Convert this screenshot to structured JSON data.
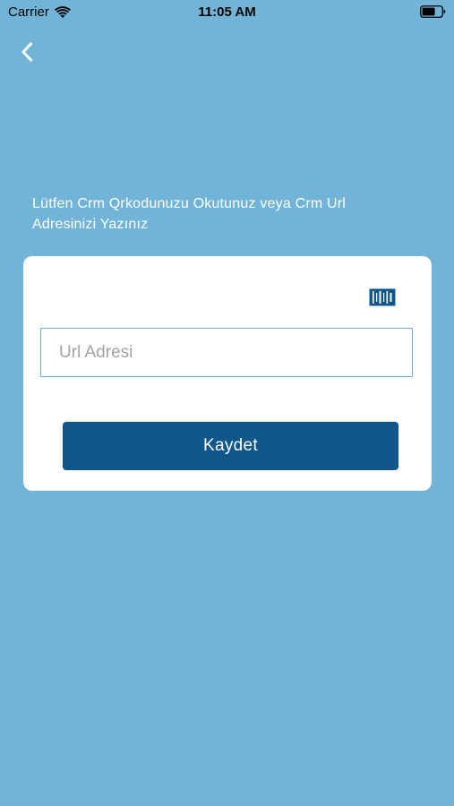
{
  "status_bar": {
    "carrier": "Carrier",
    "time": "11:05 AM"
  },
  "icons": {
    "wifi": "wifi-icon",
    "battery": "battery-icon",
    "back": "chevron-left-icon",
    "barcode": "barcode-scan-icon"
  },
  "colors": {
    "background": "#72b4d7",
    "card": "#ffffff",
    "primary_button": "#0d578c",
    "input_border": "#6fb0d3",
    "placeholder": "#a3a3a3"
  },
  "instruction": "Lütfen Crm Qrkodunuzu Okutunuz veya Crm Url Adresinizi Yazınız",
  "form": {
    "url_placeholder": "Url Adresi",
    "url_value": "",
    "save_label": "Kaydet"
  }
}
